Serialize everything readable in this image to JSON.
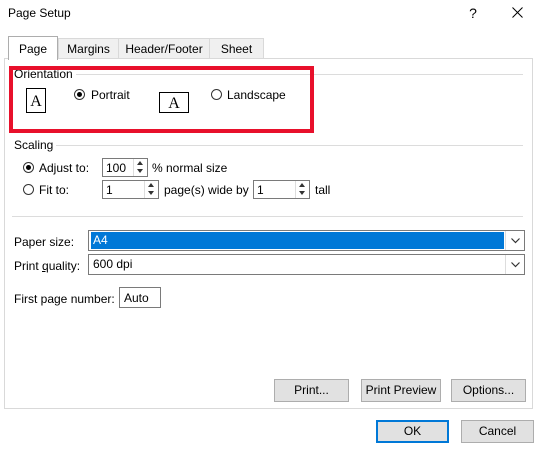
{
  "window": {
    "title": "Page Setup",
    "help": "?"
  },
  "tabs": [
    {
      "label": "Page"
    },
    {
      "label": "Margins"
    },
    {
      "label": "Header/Footer"
    },
    {
      "label": "Sheet"
    }
  ],
  "orientation": {
    "label": "Orientation",
    "portrait_icon_letter": "A",
    "landscape_icon_letter": "A",
    "portrait_label": "Portrait",
    "landscape_label": "Landscape",
    "selected": "portrait",
    "highlight_color": "#e8102b"
  },
  "scaling": {
    "label": "Scaling",
    "adjust_to_label": "Adjust to:",
    "adjust_value": "100",
    "adjust_suffix": "% normal size",
    "fit_to_label": "Fit to:",
    "fit_wide_value": "1",
    "fit_wide_suffix": "page(s) wide by",
    "fit_tall_value": "1",
    "fit_tall_suffix": "tall",
    "selected": "adjust"
  },
  "paper_size": {
    "label": "Paper size:",
    "value": "A4"
  },
  "print_quality": {
    "label": "Print quality:",
    "value": "600 dpi"
  },
  "first_page_number": {
    "label": "First page number:",
    "value": "Auto"
  },
  "buttons": {
    "print": "Print...",
    "print_preview": "Print Preview",
    "options": "Options...",
    "ok": "OK",
    "cancel": "Cancel"
  },
  "colors": {
    "accent": "#0078d7"
  }
}
